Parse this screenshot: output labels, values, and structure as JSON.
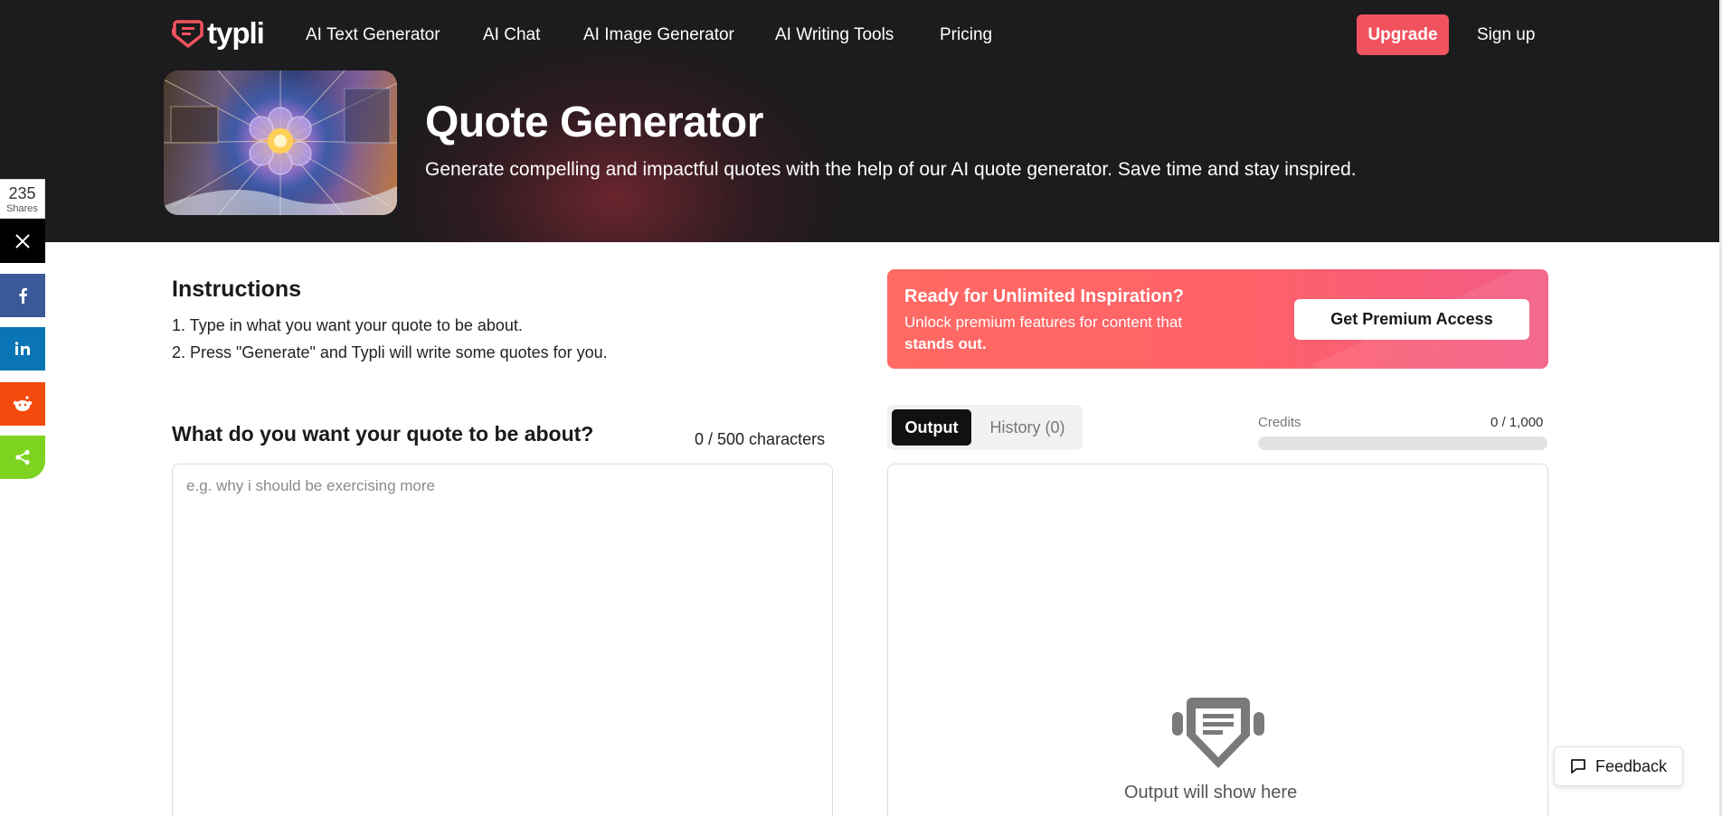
{
  "brand": {
    "name": "typli",
    "accent": "#f0535e"
  },
  "nav": {
    "items": [
      "AI Text Generator",
      "AI Chat",
      "AI Image Generator",
      "AI Writing Tools",
      "Pricing"
    ],
    "upgrade_label": "Upgrade",
    "signup_label": "Sign up"
  },
  "hero": {
    "title": "Quote Generator",
    "subtitle": "Generate compelling and impactful quotes with the help of our AI quote generator. Save time and stay inspired."
  },
  "share": {
    "count": "235",
    "count_label": "Shares",
    "networks": [
      "x-icon",
      "facebook-icon",
      "linkedin-icon",
      "reddit-icon",
      "share-icon"
    ]
  },
  "instructions": {
    "title": "Instructions",
    "steps": [
      "1. Type in what you want your quote to be about.",
      "2. Press \"Generate\" and Typli will write some quotes for you."
    ]
  },
  "input": {
    "label": "What do you want your quote to be about?",
    "char_count": "0 / 500 characters",
    "placeholder": "e.g. why i should be exercising more",
    "value": ""
  },
  "promo": {
    "title": "Ready for Unlimited Inspiration?",
    "text": "Unlock premium features for content that",
    "text_bold": "stands out.",
    "button_label": "Get Premium Access"
  },
  "output": {
    "tabs": [
      "Output",
      "History (0)"
    ],
    "active_tab": "Output",
    "credits_label": "Credits",
    "credits_value": "0 / 1,000",
    "credits_fraction": 0,
    "placeholder": "Output will show here"
  },
  "feedback": {
    "label": "Feedback"
  }
}
